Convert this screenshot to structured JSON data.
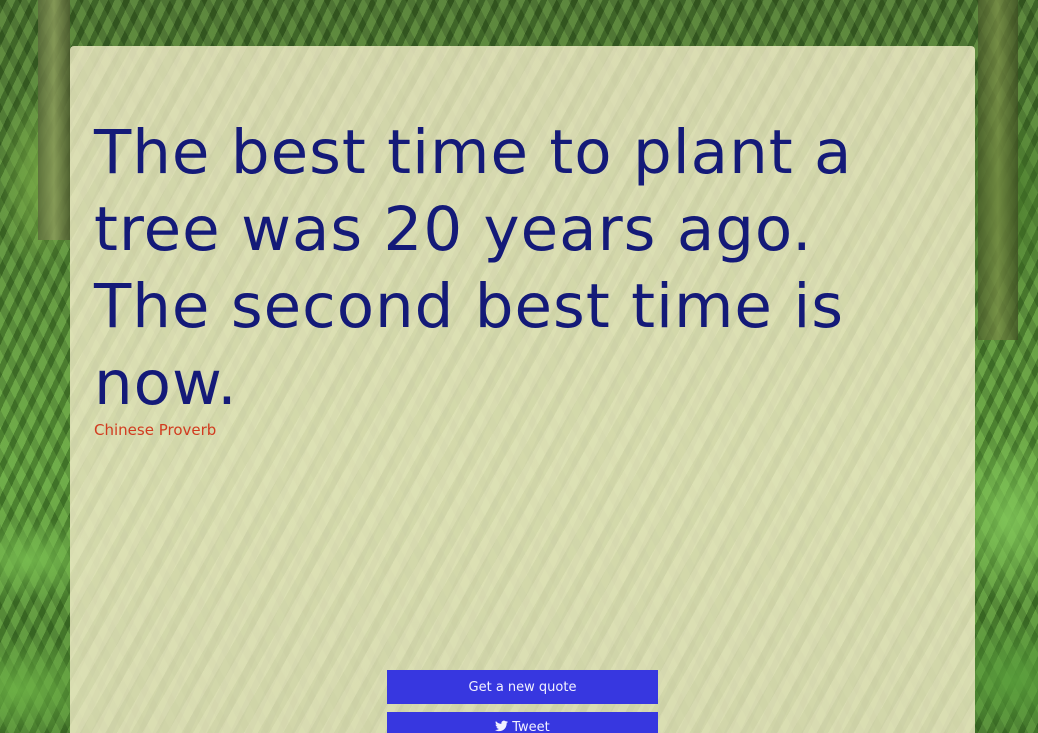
{
  "quote": {
    "text": "The best time to plant a tree was 20 years ago. The second best time is now.",
    "author": "Chinese Proverb"
  },
  "buttons": {
    "new_quote_label": "Get a new quote",
    "tweet_label": "Tweet"
  },
  "colors": {
    "quote_text": "#141a78",
    "author_text": "#d23b1f",
    "button_bg": "#3737e0",
    "card_bg": "#ece8c4"
  },
  "icons": {
    "tweet": "twitter-icon"
  }
}
